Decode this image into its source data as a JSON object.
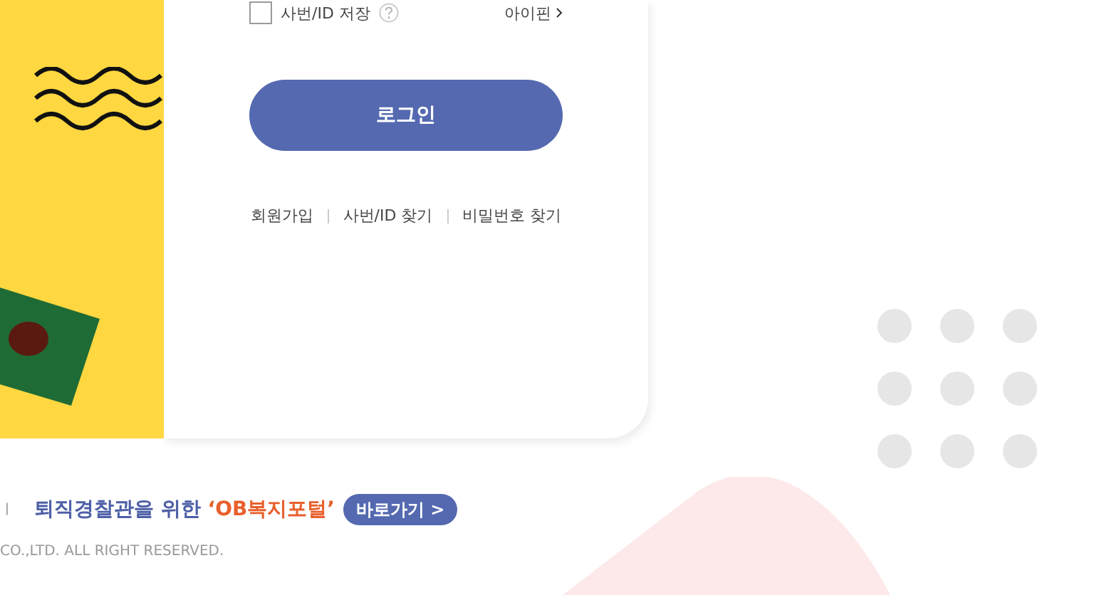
{
  "login_options": {
    "save_id": {
      "label": "사번/ID 저장",
      "checked": false
    },
    "ipin_link": "아이핀"
  },
  "login_button": "로그인",
  "links": [
    "회원가입",
    "사번/ID 찾기",
    "비밀번호 찾기"
  ],
  "footer": {
    "separator": "ㅣ",
    "portal_text": "퇴직경찰관을 위한 **‘OB복지포털’**",
    "portal_button": "바로가기 >",
    "copyright": "CO.,LTD. ALL RIGHT RESERVED."
  }
}
